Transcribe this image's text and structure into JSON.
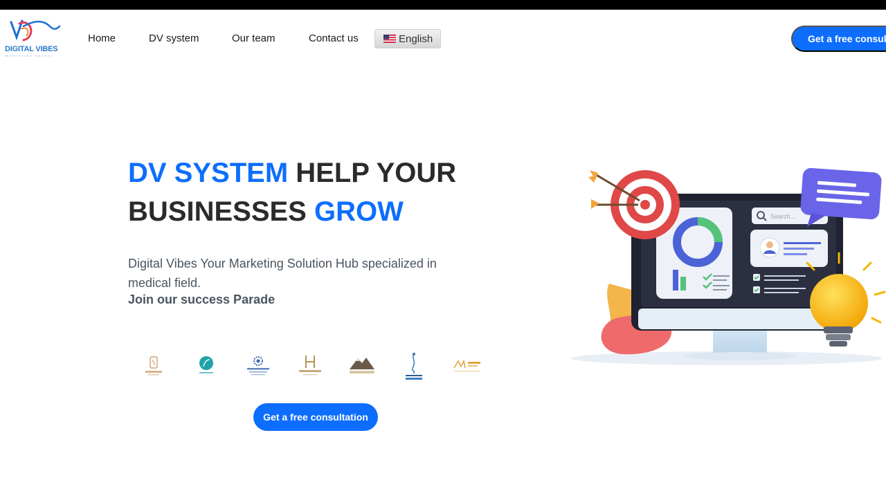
{
  "brand": {
    "name": "DIGITAL VIBES",
    "tagline": "MARKETING AGENCY"
  },
  "nav": {
    "items": [
      {
        "label": "Home"
      },
      {
        "label": "DV system"
      },
      {
        "label": "Our team"
      },
      {
        "label": "Contact us"
      }
    ],
    "language": "English",
    "cta": "Get a free consultation"
  },
  "hero": {
    "title_part1": "DV SYSTEM",
    "title_part2": " HELP YOUR BUSINESSES ",
    "title_part3": "GROW",
    "description": "Digital Vibes Your Marketing Solution Hub specialized in medical field.",
    "join": "Join our success Parade",
    "cta": "Get a free consultation"
  },
  "illustration": {
    "search_placeholder": "Search..."
  },
  "colors": {
    "accent": "#0d6efd",
    "heading": "#2b2b2b",
    "body_text": "#4a5560"
  }
}
